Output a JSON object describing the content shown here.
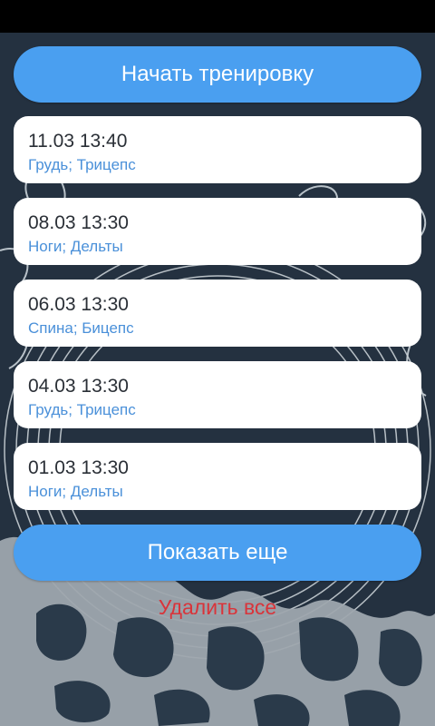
{
  "theme": {
    "accent": "#4a9ff0",
    "background": "#243140",
    "card": "#ffffff",
    "date_text": "#2a2f36",
    "muscle_text": "#4a90d9",
    "danger": "#d9343a"
  },
  "actions": {
    "start_label": "Начать тренировку",
    "more_label": "Показать еще",
    "delete_all_label": "Удалить все"
  },
  "workouts": [
    {
      "date": "11.03 13:40",
      "muscles": "Грудь; Трицепс"
    },
    {
      "date": "08.03 13:30",
      "muscles": "Ноги; Дельты"
    },
    {
      "date": "06.03 13:30",
      "muscles": "Спина; Бицепс"
    },
    {
      "date": "04.03 13:30",
      "muscles": "Грудь; Трицепс"
    },
    {
      "date": "01.03 13:30",
      "muscles": "Ноги; Дельты"
    }
  ]
}
